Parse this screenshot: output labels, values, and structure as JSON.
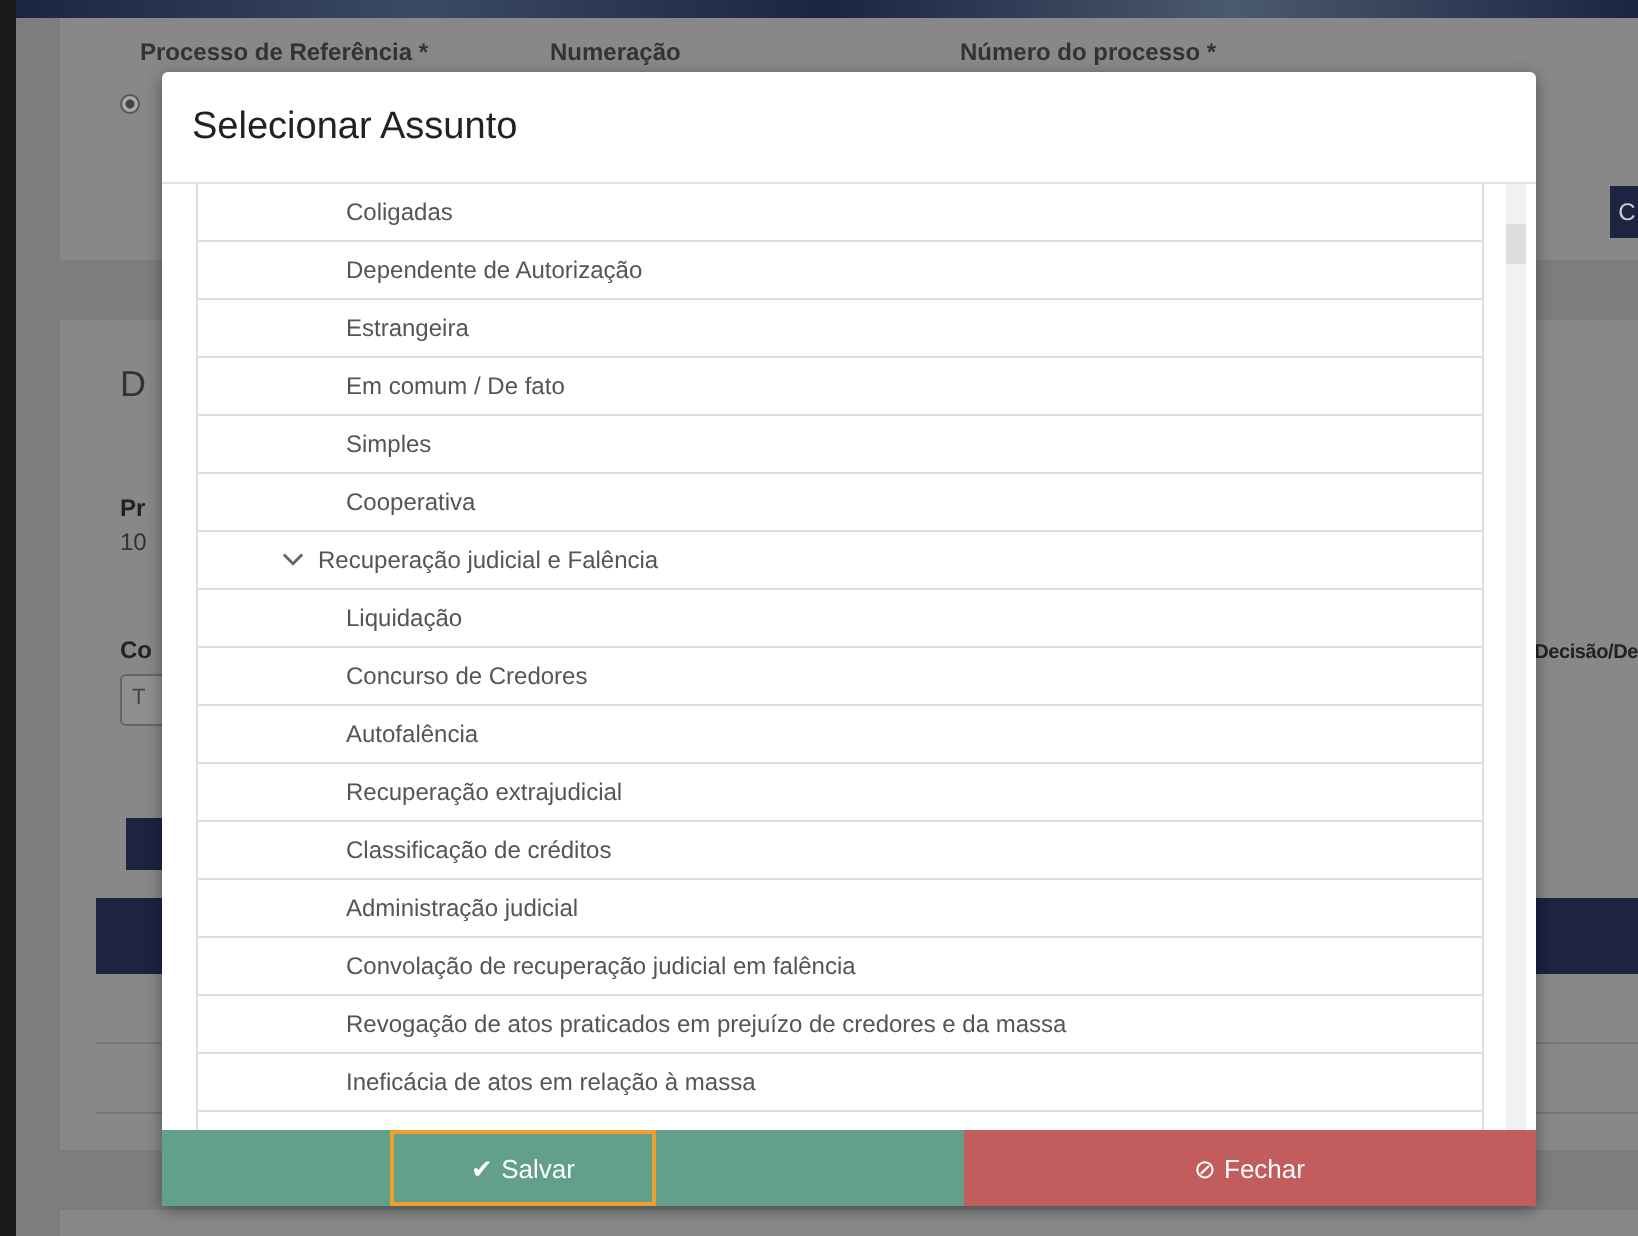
{
  "background": {
    "fields": [
      {
        "label": "Processo de Referência *"
      },
      {
        "label": "Numeração"
      },
      {
        "label": "Número do processo *"
      }
    ],
    "radio_checked": true,
    "side_button": "C",
    "section_title": "D",
    "field_label": "Pr",
    "field_value": "10",
    "filter_label": "Co",
    "filter_input": "T",
    "column_label": "Decisão/De"
  },
  "modal": {
    "title": "Selecionar Assunto",
    "tree": [
      {
        "children": [
          {
            "label": "Coligadas"
          },
          {
            "label": "Dependente de Autorização"
          },
          {
            "label": "Estrangeira"
          },
          {
            "label": "Em comum / De fato"
          },
          {
            "label": "Simples"
          },
          {
            "label": "Cooperativa"
          }
        ]
      },
      {
        "label": "Recuperação judicial e Falência",
        "expanded": true,
        "children": [
          {
            "label": "Liquidação"
          },
          {
            "label": "Concurso de Credores"
          },
          {
            "label": "Autofalência"
          },
          {
            "label": "Recuperação extrajudicial"
          },
          {
            "label": "Classificação de créditos"
          },
          {
            "label": "Administração judicial"
          },
          {
            "label": "Convolação de recuperação judicial em falência"
          },
          {
            "label": "Revogação de atos praticados em prejuízo de credores e da massa"
          },
          {
            "label": "Ineficácia de atos em relação à massa"
          }
        ]
      }
    ],
    "buttons": [
      {
        "kind": "save",
        "label": "Salvar",
        "icon": "✔",
        "focused": true
      },
      {
        "kind": "close",
        "label": "Fechar",
        "icon": "⊘",
        "focused": false
      }
    ]
  }
}
